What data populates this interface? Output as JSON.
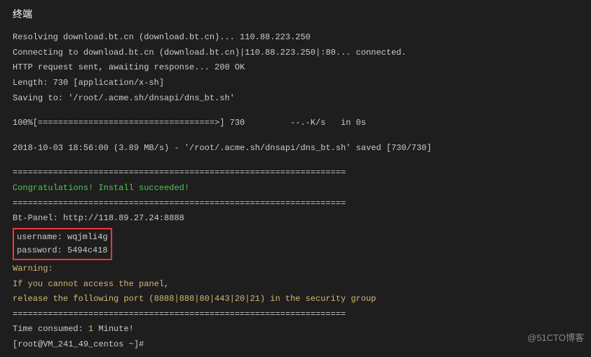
{
  "title": "终端",
  "lines": {
    "resolving": "Resolving download.bt.cn (download.bt.cn)... 110.88.223.250",
    "connecting": "Connecting to download.bt.cn (download.bt.cn)|110.88.223.250|:80... connected.",
    "http_request": "HTTP request sent, awaiting response... 200 OK",
    "length": "Length: 730 [application/x-sh]",
    "saving_to": "Saving to: '/root/.acme.sh/dnsapi/dns_bt.sh'",
    "progress": "100%[===================================>] 730         --.-K/s   in 0s",
    "saved": "2018-10-03 18:56:00 (3.89 MB/s) - '/root/.acme.sh/dnsapi/dns_bt.sh' saved [730/730]",
    "divider1": "==================================================================",
    "congrats": "Congratulations! Install succeeded!",
    "divider2": "==================================================================",
    "bt_panel": "Bt-Panel: http://118.89.27.24:8888",
    "username": "username: wqjmli4g",
    "password": "password: 5494c418",
    "warning": "Warning:",
    "warning_line1": "If you cannot access the panel,",
    "warning_line2": "release the following port (8888|888|80|443|20|21) in the security group",
    "divider3": "==================================================================",
    "time_consumed_prefix": "Time consumed: ",
    "time_consumed_value": "1",
    "time_consumed_suffix": " Minute!",
    "prompt": "[root@VM_241_49_centos ~]#"
  },
  "watermark": "@51CTO博客"
}
